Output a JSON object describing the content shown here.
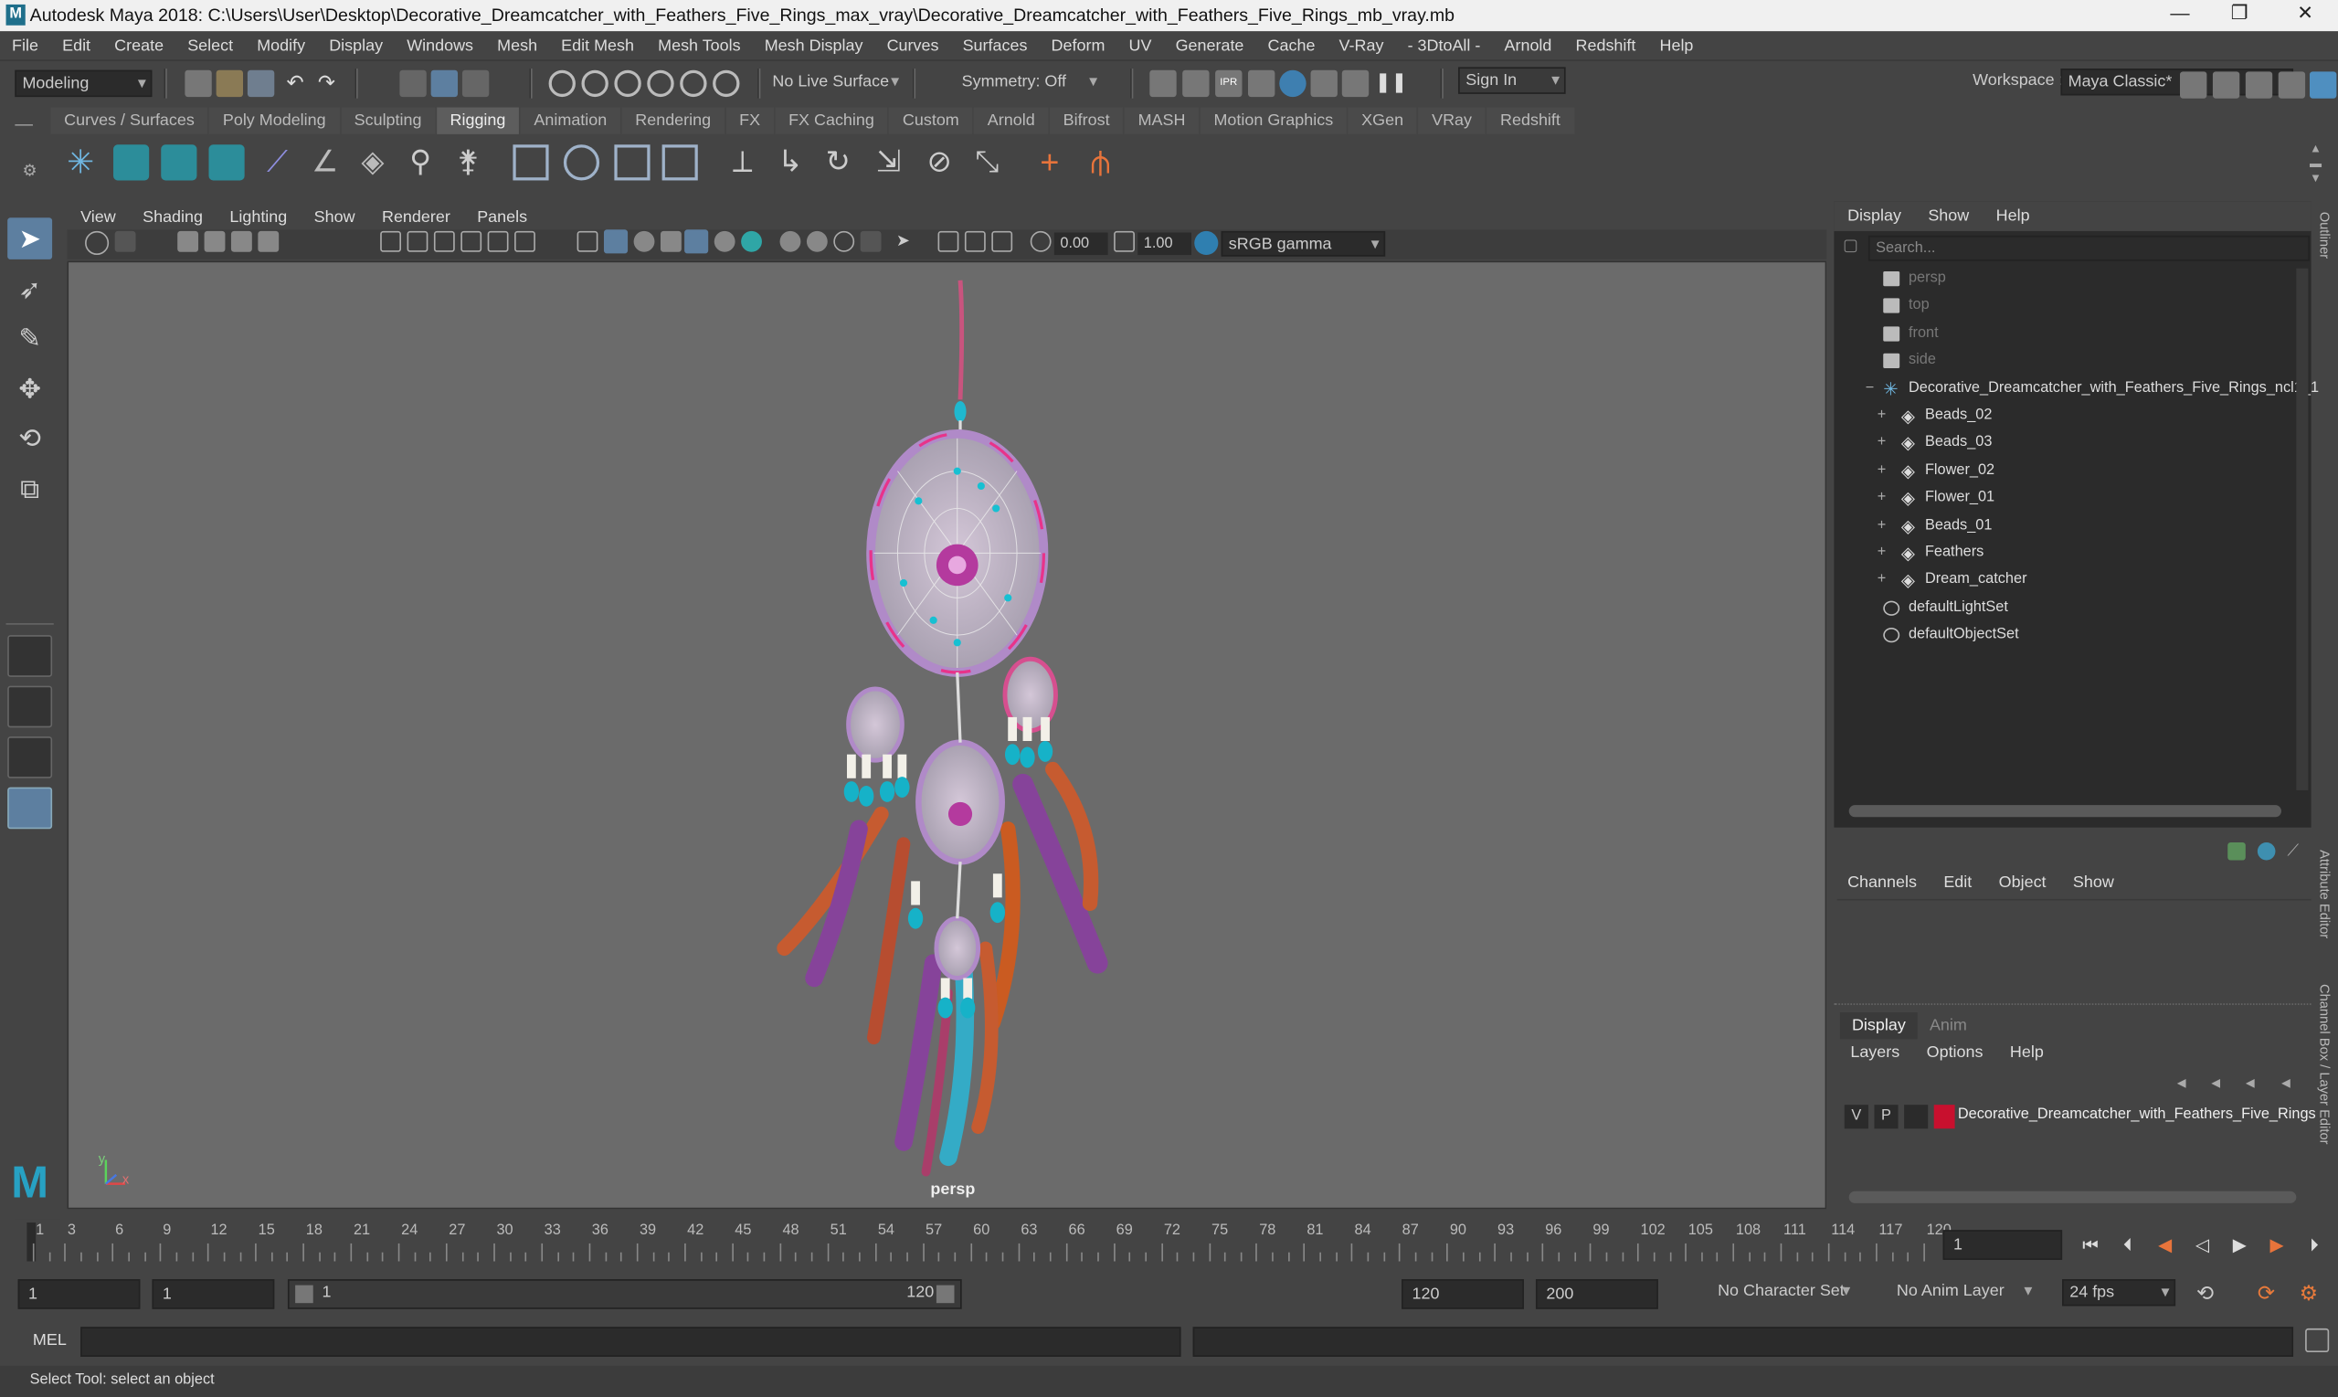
{
  "window": {
    "title": "Autodesk Maya 2018: C:\\Users\\User\\Desktop\\Decorative_Dreamcatcher_with_Feathers_Five_Rings_max_vray\\Decorative_Dreamcatcher_with_Feathers_Five_Rings_mb_vray.mb",
    "logo": "M",
    "min": "—",
    "max": "❐",
    "close": "✕"
  },
  "menus": [
    "File",
    "Edit",
    "Create",
    "Select",
    "Modify",
    "Display",
    "Windows",
    "Mesh",
    "Edit Mesh",
    "Mesh Tools",
    "Mesh Display",
    "Curves",
    "Surfaces",
    "Deform",
    "UV",
    "Generate",
    "Cache",
    "V-Ray",
    "- 3DtoAll -",
    "Arnold",
    "Redshift",
    "Help"
  ],
  "statusline": {
    "mode": "Modeling",
    "live_surface": "No Live Surface",
    "symmetry": "Symmetry: Off",
    "signin": "Sign In",
    "workspace_label": "Workspace :",
    "workspace": "Maya Classic*"
  },
  "shelf_tabs": [
    "Curves / Surfaces",
    "Poly Modeling",
    "Sculpting",
    "Rigging",
    "Animation",
    "Rendering",
    "FX",
    "FX Caching",
    "Custom",
    "Arnold",
    "Bifrost",
    "MASH",
    "Motion Graphics",
    "XGen",
    "VRay",
    "Redshift"
  ],
  "active_shelf": "Rigging",
  "viewport": {
    "menus": [
      "View",
      "Shading",
      "Lighting",
      "Show",
      "Renderer",
      "Panels"
    ],
    "exposure": "0.00",
    "gamma": "1.00",
    "colorspace": "sRGB gamma",
    "camera_label": "persp",
    "axis_x": "x",
    "axis_y": "y"
  },
  "outliner": {
    "menus": [
      "Display",
      "Show",
      "Help"
    ],
    "search_placeholder": "Search...",
    "items": [
      {
        "label": "persp",
        "dim": true,
        "indent": 0,
        "icon": "camera-icon"
      },
      {
        "label": "top",
        "dim": true,
        "indent": 0,
        "icon": "camera-icon"
      },
      {
        "label": "front",
        "dim": true,
        "indent": 0,
        "icon": "camera-icon"
      },
      {
        "label": "side",
        "dim": true,
        "indent": 0,
        "icon": "camera-icon"
      },
      {
        "label": "Decorative_Dreamcatcher_with_Feathers_Five_Rings_ncl1_1",
        "dim": false,
        "indent": 0,
        "icon": "group-icon",
        "expander": "−"
      },
      {
        "label": "Beads_02",
        "dim": false,
        "indent": 1,
        "icon": "mesh-icon",
        "expander": "+"
      },
      {
        "label": "Beads_03",
        "dim": false,
        "indent": 1,
        "icon": "mesh-icon",
        "expander": "+"
      },
      {
        "label": "Flower_02",
        "dim": false,
        "indent": 1,
        "icon": "mesh-icon",
        "expander": "+"
      },
      {
        "label": "Flower_01",
        "dim": false,
        "indent": 1,
        "icon": "mesh-icon",
        "expander": "+"
      },
      {
        "label": "Beads_01",
        "dim": false,
        "indent": 1,
        "icon": "mesh-icon",
        "expander": "+"
      },
      {
        "label": "Feathers",
        "dim": false,
        "indent": 1,
        "icon": "mesh-icon",
        "expander": "+"
      },
      {
        "label": "Dream_catcher",
        "dim": false,
        "indent": 1,
        "icon": "mesh-icon",
        "expander": "+"
      },
      {
        "label": "defaultLightSet",
        "dim": false,
        "indent": 0,
        "icon": "set-icon"
      },
      {
        "label": "defaultObjectSet",
        "dim": false,
        "indent": 0,
        "icon": "set-icon"
      }
    ]
  },
  "channelbox": {
    "menus": [
      "Channels",
      "Edit",
      "Object",
      "Show"
    ]
  },
  "layer_editor": {
    "tabs": [
      "Display",
      "Anim"
    ],
    "menus": [
      "Layers",
      "Options",
      "Help"
    ],
    "layer": {
      "v": "V",
      "p": "P",
      "name": "Decorative_Dreamcatcher_with_Feathers_Five_Rings",
      "color": "#c8102e"
    }
  },
  "side_tabs": [
    "Outliner",
    "Attribute Editor",
    "Channel Box / Layer Editor"
  ],
  "timeline": {
    "ticks": [
      "1",
      "3",
      "6",
      "9",
      "12",
      "15",
      "18",
      "21",
      "24",
      "27",
      "30",
      "33",
      "36",
      "39",
      "42",
      "45",
      "48",
      "51",
      "54",
      "57",
      "60",
      "63",
      "66",
      "69",
      "72",
      "75",
      "78",
      "81",
      "84",
      "87",
      "90",
      "93",
      "96",
      "99",
      "102",
      "105",
      "108",
      "111",
      "114",
      "117",
      "120"
    ],
    "current_frame": "1"
  },
  "range": {
    "start": "1",
    "anim_start": "1",
    "slider_start": "1",
    "slider_end": "120",
    "end": "120",
    "anim_end": "200",
    "char_set": "No Character Set",
    "anim_layer": "No Anim Layer",
    "fps": "24 fps"
  },
  "cmd": {
    "label": "MEL"
  },
  "help": {
    "text": "Select Tool: select an object"
  }
}
